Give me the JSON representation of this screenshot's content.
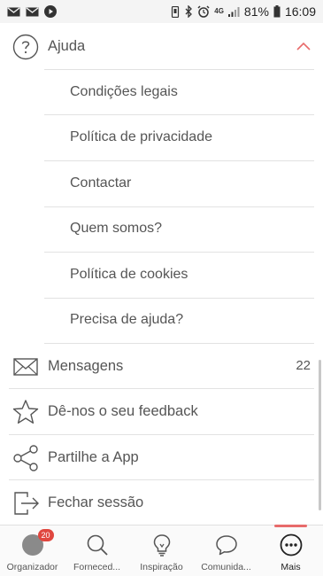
{
  "status_bar": {
    "battery": "81%",
    "time": "16:09",
    "network": "4G"
  },
  "help_section": {
    "title": "Ajuda",
    "items": [
      {
        "label": "Condições legais"
      },
      {
        "label": "Política de privacidade"
      },
      {
        "label": "Contactar"
      },
      {
        "label": "Quem somos?"
      },
      {
        "label": "Política de cookies"
      },
      {
        "label": "Precisa de ajuda?"
      }
    ]
  },
  "menu": {
    "messages": {
      "label": "Mensagens",
      "count": "22"
    },
    "feedback": {
      "label": "Dê-nos o seu feedback"
    },
    "share": {
      "label": "Partilhe a App"
    },
    "logout": {
      "label": "Fechar sessão"
    }
  },
  "bottom_nav": {
    "items": [
      {
        "label": "Organizador",
        "icon": "avatar-icon",
        "badge": "20"
      },
      {
        "label": "Forneced...",
        "icon": "search-icon"
      },
      {
        "label": "Inspiração",
        "icon": "lightbulb-icon"
      },
      {
        "label": "Comunida...",
        "icon": "chat-bubble-icon"
      },
      {
        "label": "Mais",
        "icon": "more-icon",
        "active": true
      }
    ]
  },
  "colors": {
    "accent": "#e86b6b",
    "badge": "#e0473f",
    "text": "#555555",
    "divider": "#e2e2e2"
  }
}
